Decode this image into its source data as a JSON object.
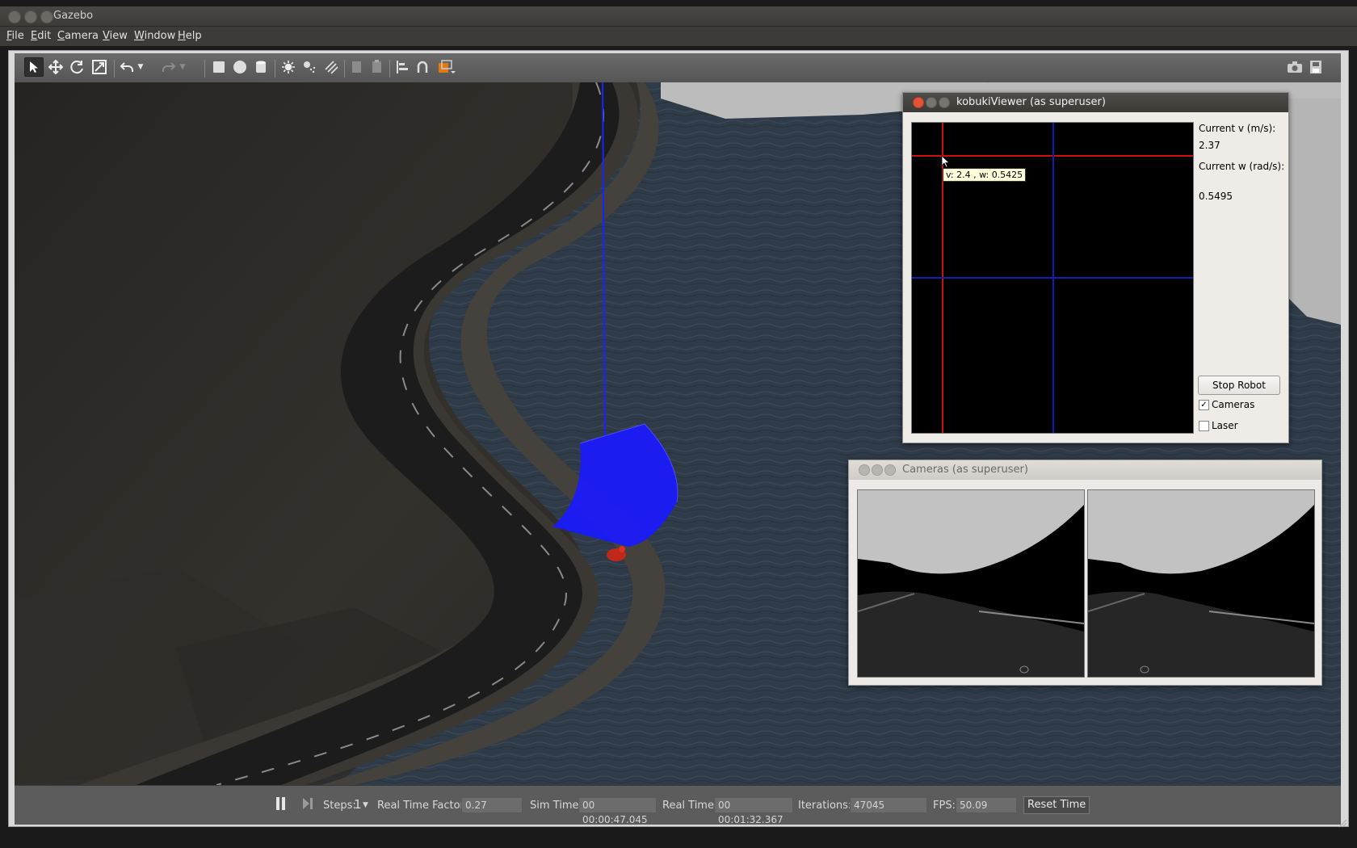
{
  "window": {
    "title": "Gazebo"
  },
  "menu": [
    "File",
    "Edit",
    "Camera",
    "View",
    "Window",
    "Help"
  ],
  "toolbar": {
    "tools": [
      "select-arrow",
      "translate",
      "rotate",
      "scale",
      "undo",
      "undo-dropdown",
      "redo",
      "redo-dropdown",
      "box-shape",
      "sphere-shape",
      "cylinder-shape",
      "point-light",
      "spot-light",
      "directional-light",
      "copy",
      "paste",
      "align",
      "snap",
      "change-view"
    ],
    "right_tools": [
      "screenshot",
      "log-record"
    ]
  },
  "kobuki_viewer": {
    "title": "kobukiViewer (as superuser)",
    "tooltip": "v: 2.4 , w: 0.5425",
    "current_v_label": "Current v (m/s):",
    "current_v_value": "2.37",
    "current_w_label": "Current w (rad/s):",
    "current_w_value": "0.5495",
    "stop_button": "Stop Robot",
    "cameras_label": "Cameras",
    "cameras_checked": true,
    "laser_label": "Laser",
    "laser_checked": false
  },
  "cameras_window": {
    "title": "Cameras (as superuser)"
  },
  "bottom_bar": {
    "steps_label": "Steps:",
    "steps_value": "1",
    "rtf_label": "Real Time Factor:",
    "rtf_value": "0.27",
    "sim_time_label": "Sim Time:",
    "sim_time_value": "00 00:00:47.045",
    "real_time_label": "Real Time:",
    "real_time_value": "00 00:01:32.367",
    "iterations_label": "Iterations:",
    "iterations_value": "47045",
    "fps_label": "FPS:",
    "fps_value": "50.09",
    "reset_button": "Reset Time"
  },
  "colors": {
    "laser_blue": "#1a1aff",
    "crosshair_red": "#d01010",
    "crosshair_blue": "#1020b0",
    "water": "#2e3a48"
  }
}
